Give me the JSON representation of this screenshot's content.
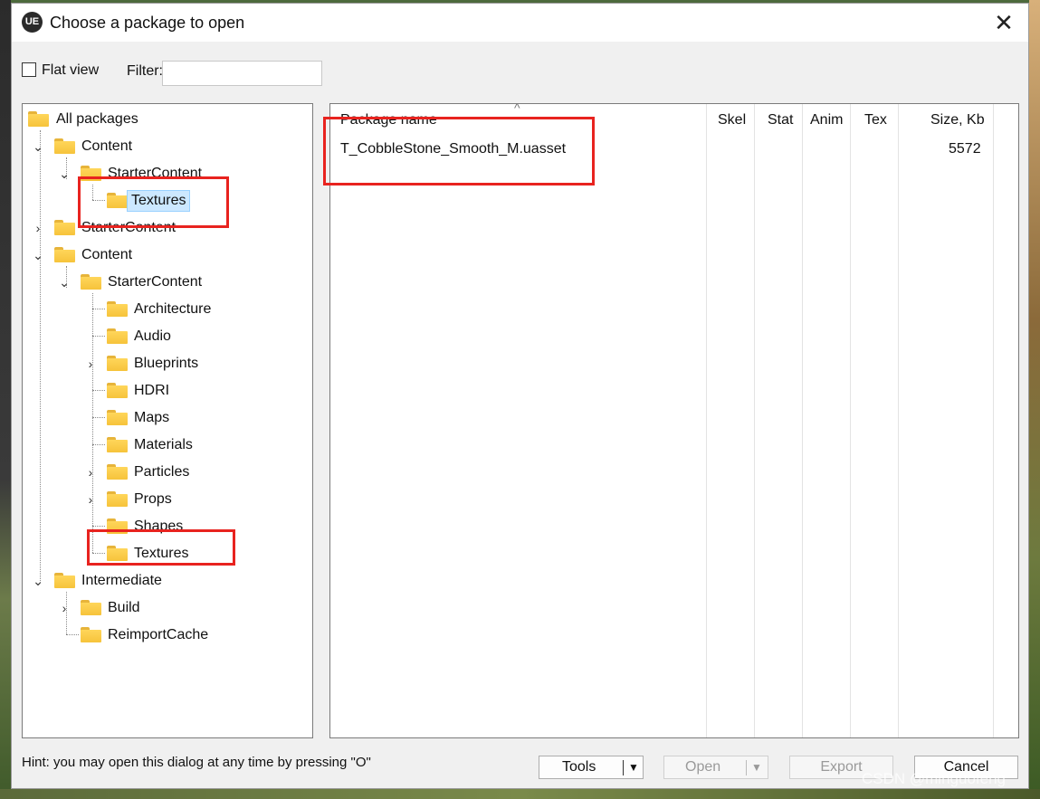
{
  "window": {
    "title": "Choose a package to open",
    "logo": "UE"
  },
  "toolbar": {
    "flat_view_label": "Flat view",
    "flat_view_checked": false,
    "filter_label": "Filter:",
    "filter_value": ""
  },
  "tree": [
    "All packages",
    "Content",
    "StarterContent",
    "Textures",
    "StarterContent",
    "Content",
    "StarterContent",
    "Architecture",
    "Audio",
    "Blueprints",
    "HDRI",
    "Maps",
    "Materials",
    "Particles",
    "Props",
    "Shapes",
    "Textures",
    "Intermediate",
    "Build",
    "ReimportCache"
  ],
  "list": {
    "columns": [
      "Package name",
      "Skel",
      "Stat",
      "Anim",
      "Tex",
      "Size, Kb"
    ],
    "rows": [
      {
        "name": "T_CobbleStone_Smooth_M.uasset",
        "size": "5572"
      }
    ]
  },
  "footer": {
    "hint": "Hint: you may open this dialog at any time by pressing \"O\"",
    "tools_label": "Tools",
    "open_label": "Open",
    "export_label": "Export",
    "cancel_label": "Cancel"
  },
  "watermark": "CSDN @minguofeng",
  "highlight_color": "#e8231f"
}
